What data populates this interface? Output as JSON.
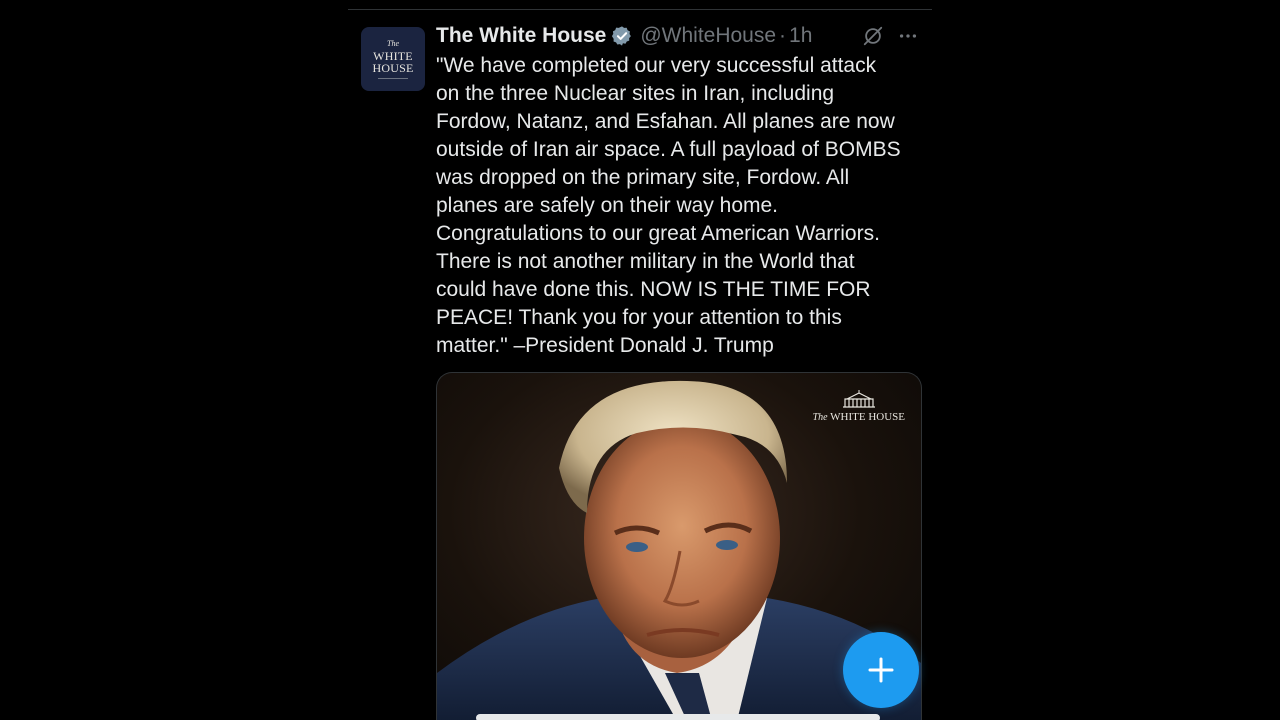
{
  "tweet": {
    "avatar": {
      "line1": "The",
      "line2": "WHITE",
      "line3": "HOUSE"
    },
    "display_name": "The White House",
    "handle": "@WhiteHouse",
    "separator": "·",
    "time": "1h",
    "text": "\"We have completed our very successful attack\non the three Nuclear sites in Iran, including\nFordow, Natanz, and Esfahan. All planes are now\noutside of Iran air space. A full payload of BOMBS\nwas dropped on the primary site, Fordow. All\nplanes are safely on their way home.\nCongratulations to our great American Warriors.\nThere is not another military in the World that\ncould have done this. NOW IS THE TIME FOR\nPEACE! Thank you for your attention to this\nmatter.\" –President Donald J. Trump",
    "media": {
      "watermark_the": "The",
      "watermark_name": "WHITE HOUSE"
    }
  },
  "icons": {
    "verified": "verified-badge-icon",
    "grok": "grok-icon",
    "more": "more-horizontal-icon",
    "compose": "plus-icon"
  },
  "colors": {
    "background": "#000000",
    "text_primary": "#e7e9ea",
    "text_secondary": "#71767b",
    "accent": "#1d9bf0",
    "divider": "#2f3336"
  }
}
